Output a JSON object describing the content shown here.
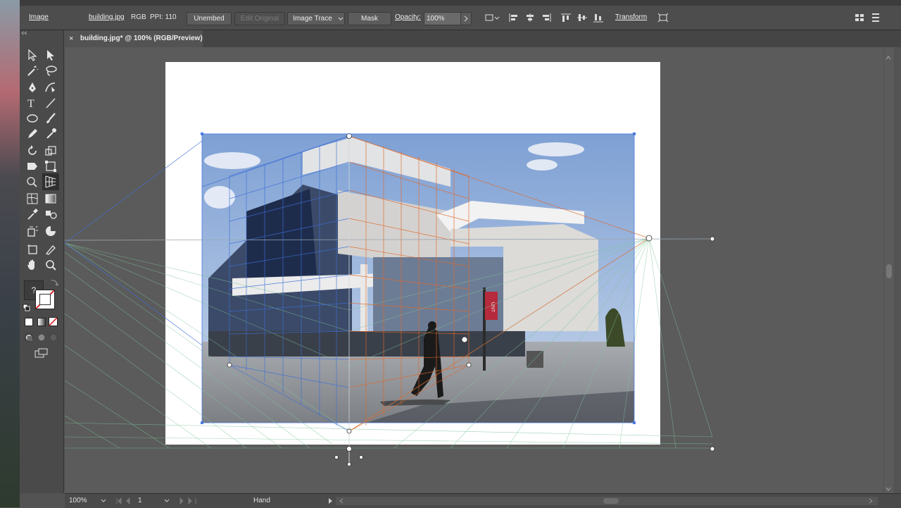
{
  "window": {
    "tab_title": "building.jpg* @ 100% (RGB/Preview)"
  },
  "control_bar": {
    "object_type": "Image",
    "file_name": "building.jpg",
    "color_mode": "RGB",
    "ppi": "PPI: 110",
    "unembed_label": "Unembed",
    "edit_original_label": "Edit Original",
    "image_trace_label": "Image Trace",
    "mask_label": "Mask",
    "opacity_label": "Opacity:",
    "opacity_value": "100%",
    "transform_label": "Transform"
  },
  "status_bar": {
    "zoom": "100%",
    "artboard_number": "1",
    "current_tool": "Hand"
  },
  "toolbox": {
    "unknown_label": "?"
  },
  "colors": {
    "perspective_left": "#3d6fd6",
    "perspective_right": "#e0682a",
    "ground_plane": "#7fc49a",
    "horizon": "#9aa6b0",
    "accent": "#d8262e"
  },
  "photo": {
    "banner_text": "UNT"
  }
}
